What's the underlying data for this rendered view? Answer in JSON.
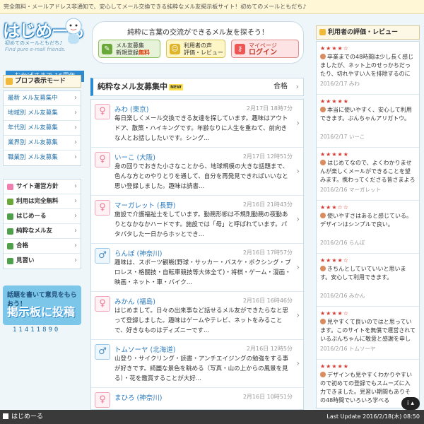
{
  "topbar": {
    "text": "完全無料・メールアドレス非通知で、安心してメール交換できる純粋なメル友掲示板サイト！初めてのメールともだち♪"
  },
  "header": {
    "logo": "はじめーる",
    "logo_sub": "初めてのメールともだち♪",
    "logo_en": "Find pure e-mail friends.",
    "anniversary": "おかげさまで 16周年",
    "hero_title": "純粋に言葉の交流ができるメル友を探そう！",
    "buttons": [
      {
        "line1": "メル友募集",
        "line2a": "新規登録",
        "line2b": "無料"
      },
      {
        "line1": "利用者の声",
        "line2": "評価・レビュー"
      },
      {
        "line1": "マイページ",
        "line2": "ログイン"
      }
    ]
  },
  "left_sidebar": {
    "heading": "プロフ表示モード",
    "items": [
      "最新 メル友募集中",
      "地域別 メル友募集",
      "年代別 メル友募集",
      "業界別 メル友募集",
      "職業別 メル友募集"
    ],
    "menu": [
      "サイト運営方針",
      "利用は完全無料",
      "はじめーる",
      "純粋なメル友",
      "合格",
      "見習い"
    ],
    "board_line1": "話題を書いて意見をもらおう！",
    "board_line2": "掲示板に投稿",
    "counter": "11411890"
  },
  "main": {
    "heading": "純粋なメル友募集中",
    "badge": "NEW",
    "status": "合格",
    "messages": [
      {
        "name": "みわ (東京)",
        "date": "2月17日 18時7分",
        "gender": "f",
        "body": "毎日楽しくメール交換できる友達を探しています。趣味はアウトドア、散策・ハイキングです。年齢なりに人生を重ねて、前向きな人とお話ししたいです。シング..."
      },
      {
        "name": "いーこ (大阪)",
        "date": "2月17日 12時51分",
        "gender": "f",
        "body": "身の回りでおきた小さなことから、地球規模の大きな話題まで、色んな方とのやりとりを通して、自分を再発見できればいいなと思い登録しました。趣味は読書..."
      },
      {
        "name": "マーガレット (長野)",
        "date": "2月16日 21時43分",
        "gender": "f",
        "body": "施設で介護福祉士をしています。勤務形態は不規則勤務の夜勤ありとなかなかハードです。施設では「母」と呼ばれています。パタパタした一日からホッとでき..."
      },
      {
        "name": "らんぼ (神奈川)",
        "date": "2月16日 17時57分",
        "gender": "m",
        "body": "趣味は、スポーツ観戦(野球・サッカー・バスケ・ボクシング・プロレス・格闘技・自転車競技等大体全て)・将棋・ゲーム・漫画・映画・ネット・車・バイク..."
      },
      {
        "name": "みかん (福島)",
        "date": "2月16日 16時46分",
        "gender": "f",
        "body": "はじめまして。日々の出来事など話せるメル友ができたらなと思って登録しました。趣味はゲームやテレビ、ネットをみることで、好きなものはディズニーです..."
      },
      {
        "name": "トムソーヤ (北海道)",
        "date": "2月16日 12時5分",
        "gender": "m",
        "body": "山登り・サイクリング・読書・アンチエイジングの勉強をする事が好きです。綺麗な景色を眺める（写真・山の上からの風景を見る）・花を鑑賞することが大好..."
      },
      {
        "name": "まひろ (神奈川)",
        "date": "2月16日 10時51分",
        "gender": "f",
        "body": ""
      }
    ]
  },
  "reviews": {
    "heading": "利用者の評価・レビュー",
    "items": [
      {
        "stars": "★★★★☆",
        "body": "卒業までの48時間は少し長く感じましたが、ネット上のせっかちだったり、切れやすい人を排除するのにも役に立つと感じました。",
        "meta": "2016/2/17 みわ"
      },
      {
        "stars": "★★★★★",
        "body": "本当に使いやすく、安心して利用できます。ぶんちゃんアリガトウ。",
        "meta": "2016/2/17 いーこ"
      },
      {
        "stars": "★★★★★",
        "body": "はじめてなので、よくわかりませんが楽しくメールができることを望みます。携わってくださる皆さまよろしくお願いいたします",
        "meta": "2016/2/16 マーガレット"
      },
      {
        "stars": "★★★☆☆",
        "body": "使いやすさはあると感じている。デザインはシンプルで良い。",
        "meta": "2016/2/16 らんぼ"
      },
      {
        "stars": "★★★★☆",
        "body": "きちんとしていていいと思います。安心して利用できます。",
        "meta": "2016/2/16 みかん"
      },
      {
        "stars": "★★★★☆",
        "body": "見やすくて良いのではと思っています。このサイトを無償で運営されているぶんちゃんに敬意と感謝を申し上げます。",
        "meta": "2016/2/16 トムソーヤ"
      },
      {
        "stars": "★★★★★",
        "body": "デザインも見やすくわかりやすいので初めての登録でもスムーズに入力できました。見習い期間もありその48時間でいろいろ学べる",
        "meta": ""
      }
    ]
  },
  "bottombar": {
    "home": "はじめーる",
    "update": "Last Update 2016/2/18(木) 08:50",
    "info_btn": "i ▴"
  },
  "colors": {
    "accent": "#2b8ad0",
    "star": "#d43a2f",
    "link": "#2b7bbf"
  }
}
